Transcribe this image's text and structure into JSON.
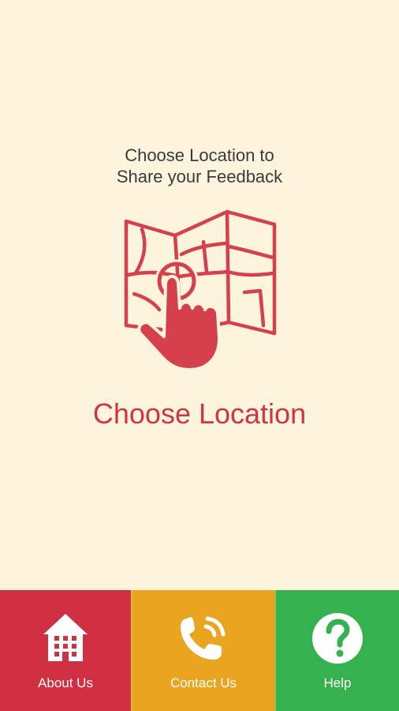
{
  "prompt": {
    "line1": "Choose Location to",
    "line2": "Share your Feedback"
  },
  "illustration": {
    "icon": "map-tap-icon",
    "color": "#d6404c"
  },
  "action": {
    "label": "Choose Location",
    "color": "#cf3545"
  },
  "bottom_nav": {
    "items": [
      {
        "label": "About Us",
        "icon": "building-icon",
        "color": "#d12f42"
      },
      {
        "label": "Contact Us",
        "icon": "phone-icon",
        "color": "#eaa520"
      },
      {
        "label": "Help",
        "icon": "help-icon",
        "color": "#35b24f"
      }
    ]
  },
  "colors": {
    "background": "#fdf4dd"
  }
}
